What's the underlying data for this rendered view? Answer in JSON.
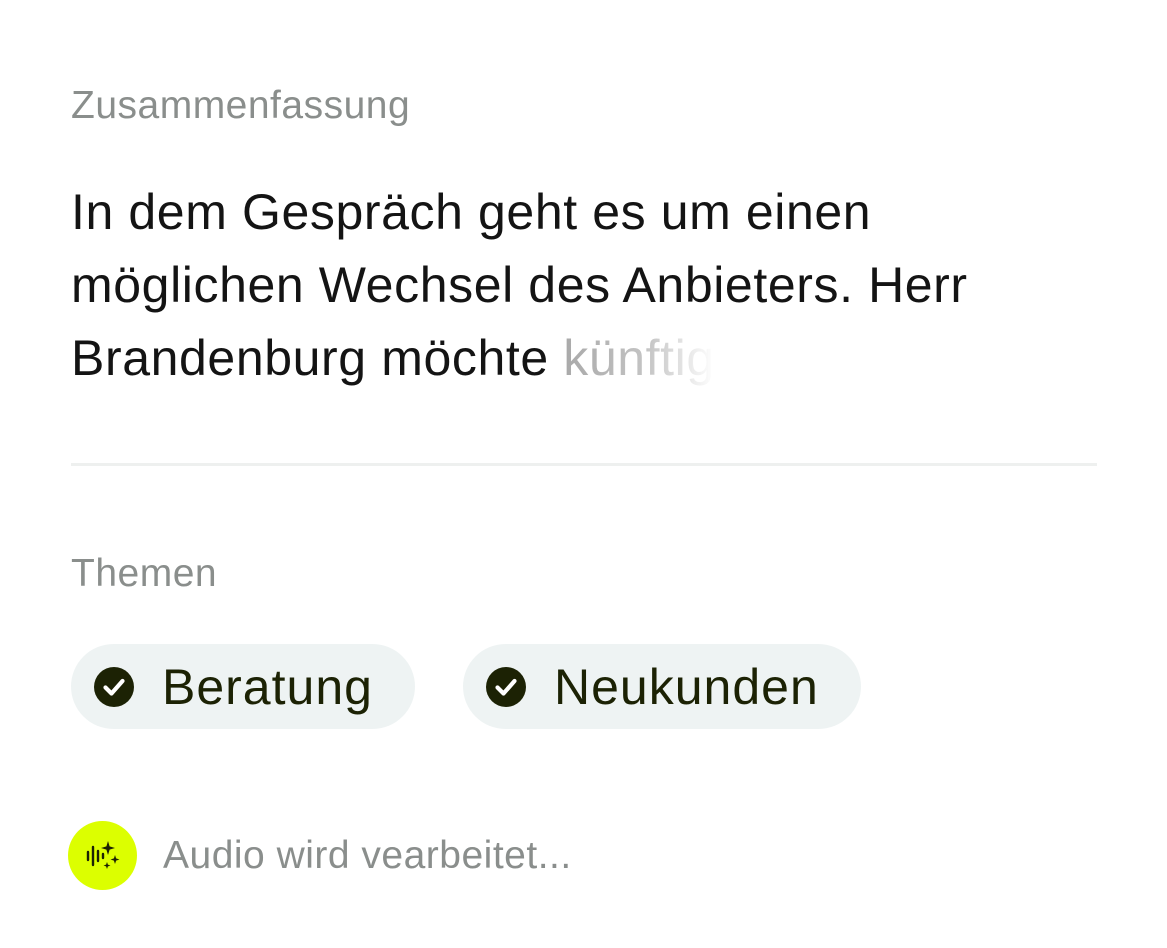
{
  "summary": {
    "label": "Zusammenfassung",
    "text_visible": "In dem Gespräch geht es um einen möglichen Wechsel des Anbieters. Herr Brandenburg möchte ",
    "text_fading": "künftig"
  },
  "topics": {
    "label": "Themen",
    "chips": [
      {
        "label": "Beratung",
        "icon": "check-circle-icon"
      },
      {
        "label": "Neukunden",
        "icon": "check-circle-icon"
      }
    ]
  },
  "status": {
    "icon": "audio-waveform-sparkle-icon",
    "text": "Audio wird vearbeitet...",
    "badge_color": "#dcff00"
  },
  "colors": {
    "label_gray": "#8a8e8c",
    "text_dark": "#141414",
    "chip_bg": "#eef3f3",
    "chip_text": "#1c2204",
    "divider": "#eef0ef"
  }
}
